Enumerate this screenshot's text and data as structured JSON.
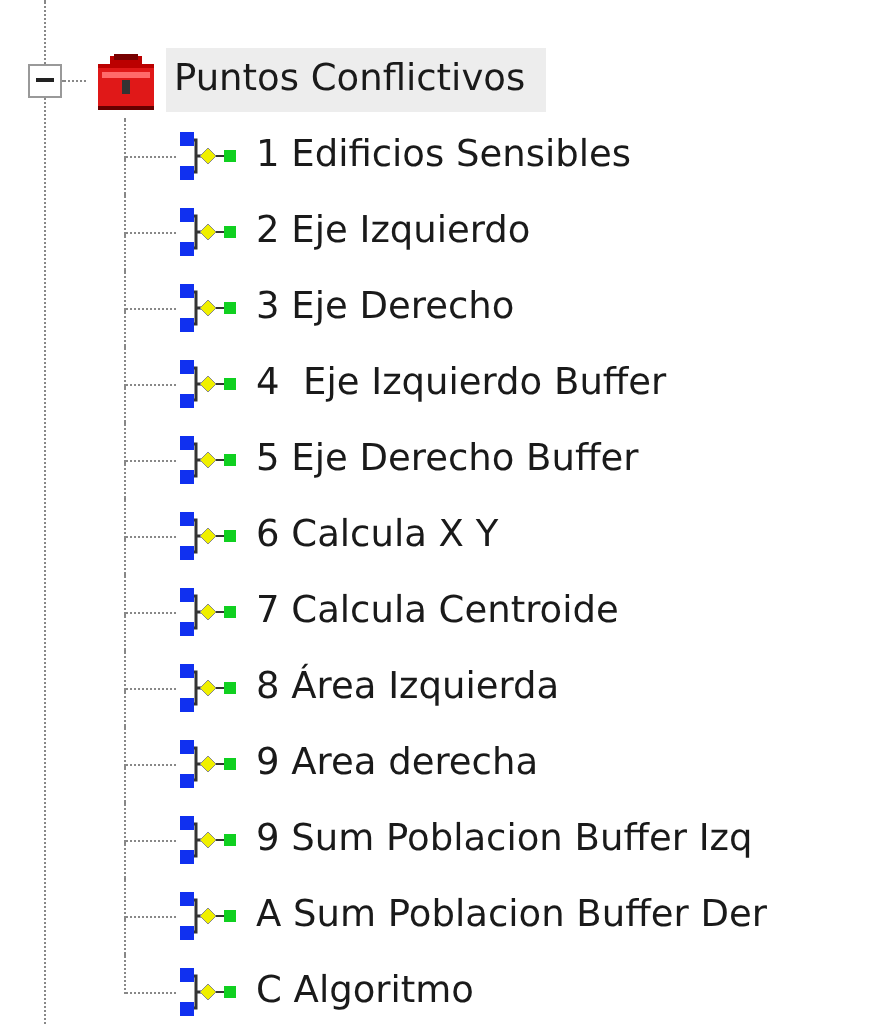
{
  "tree": {
    "label": "Puntos Conflictivos",
    "expanded": true,
    "selected": true,
    "children": [
      {
        "label": "1 Edificios Sensibles",
        "selected": false
      },
      {
        "label": "2 Eje Izquierdo",
        "selected": false
      },
      {
        "label": "3 Eje Derecho",
        "selected": false
      },
      {
        "label": "4  Eje Izquierdo Buffer",
        "selected": false
      },
      {
        "label": "5 Eje Derecho Buffer",
        "selected": false
      },
      {
        "label": "6 Calcula X Y",
        "selected": false
      },
      {
        "label": "7 Calcula Centroide",
        "selected": false
      },
      {
        "label": "8 Área Izquierda",
        "selected": false
      },
      {
        "label": "9 Area derecha",
        "selected": false
      },
      {
        "label": "9 Sum Poblacion Buffer Izq",
        "selected": false
      },
      {
        "label": "A Sum Poblacion Buffer Der",
        "selected": false
      },
      {
        "label": "C Algoritmo",
        "selected": false
      }
    ]
  }
}
